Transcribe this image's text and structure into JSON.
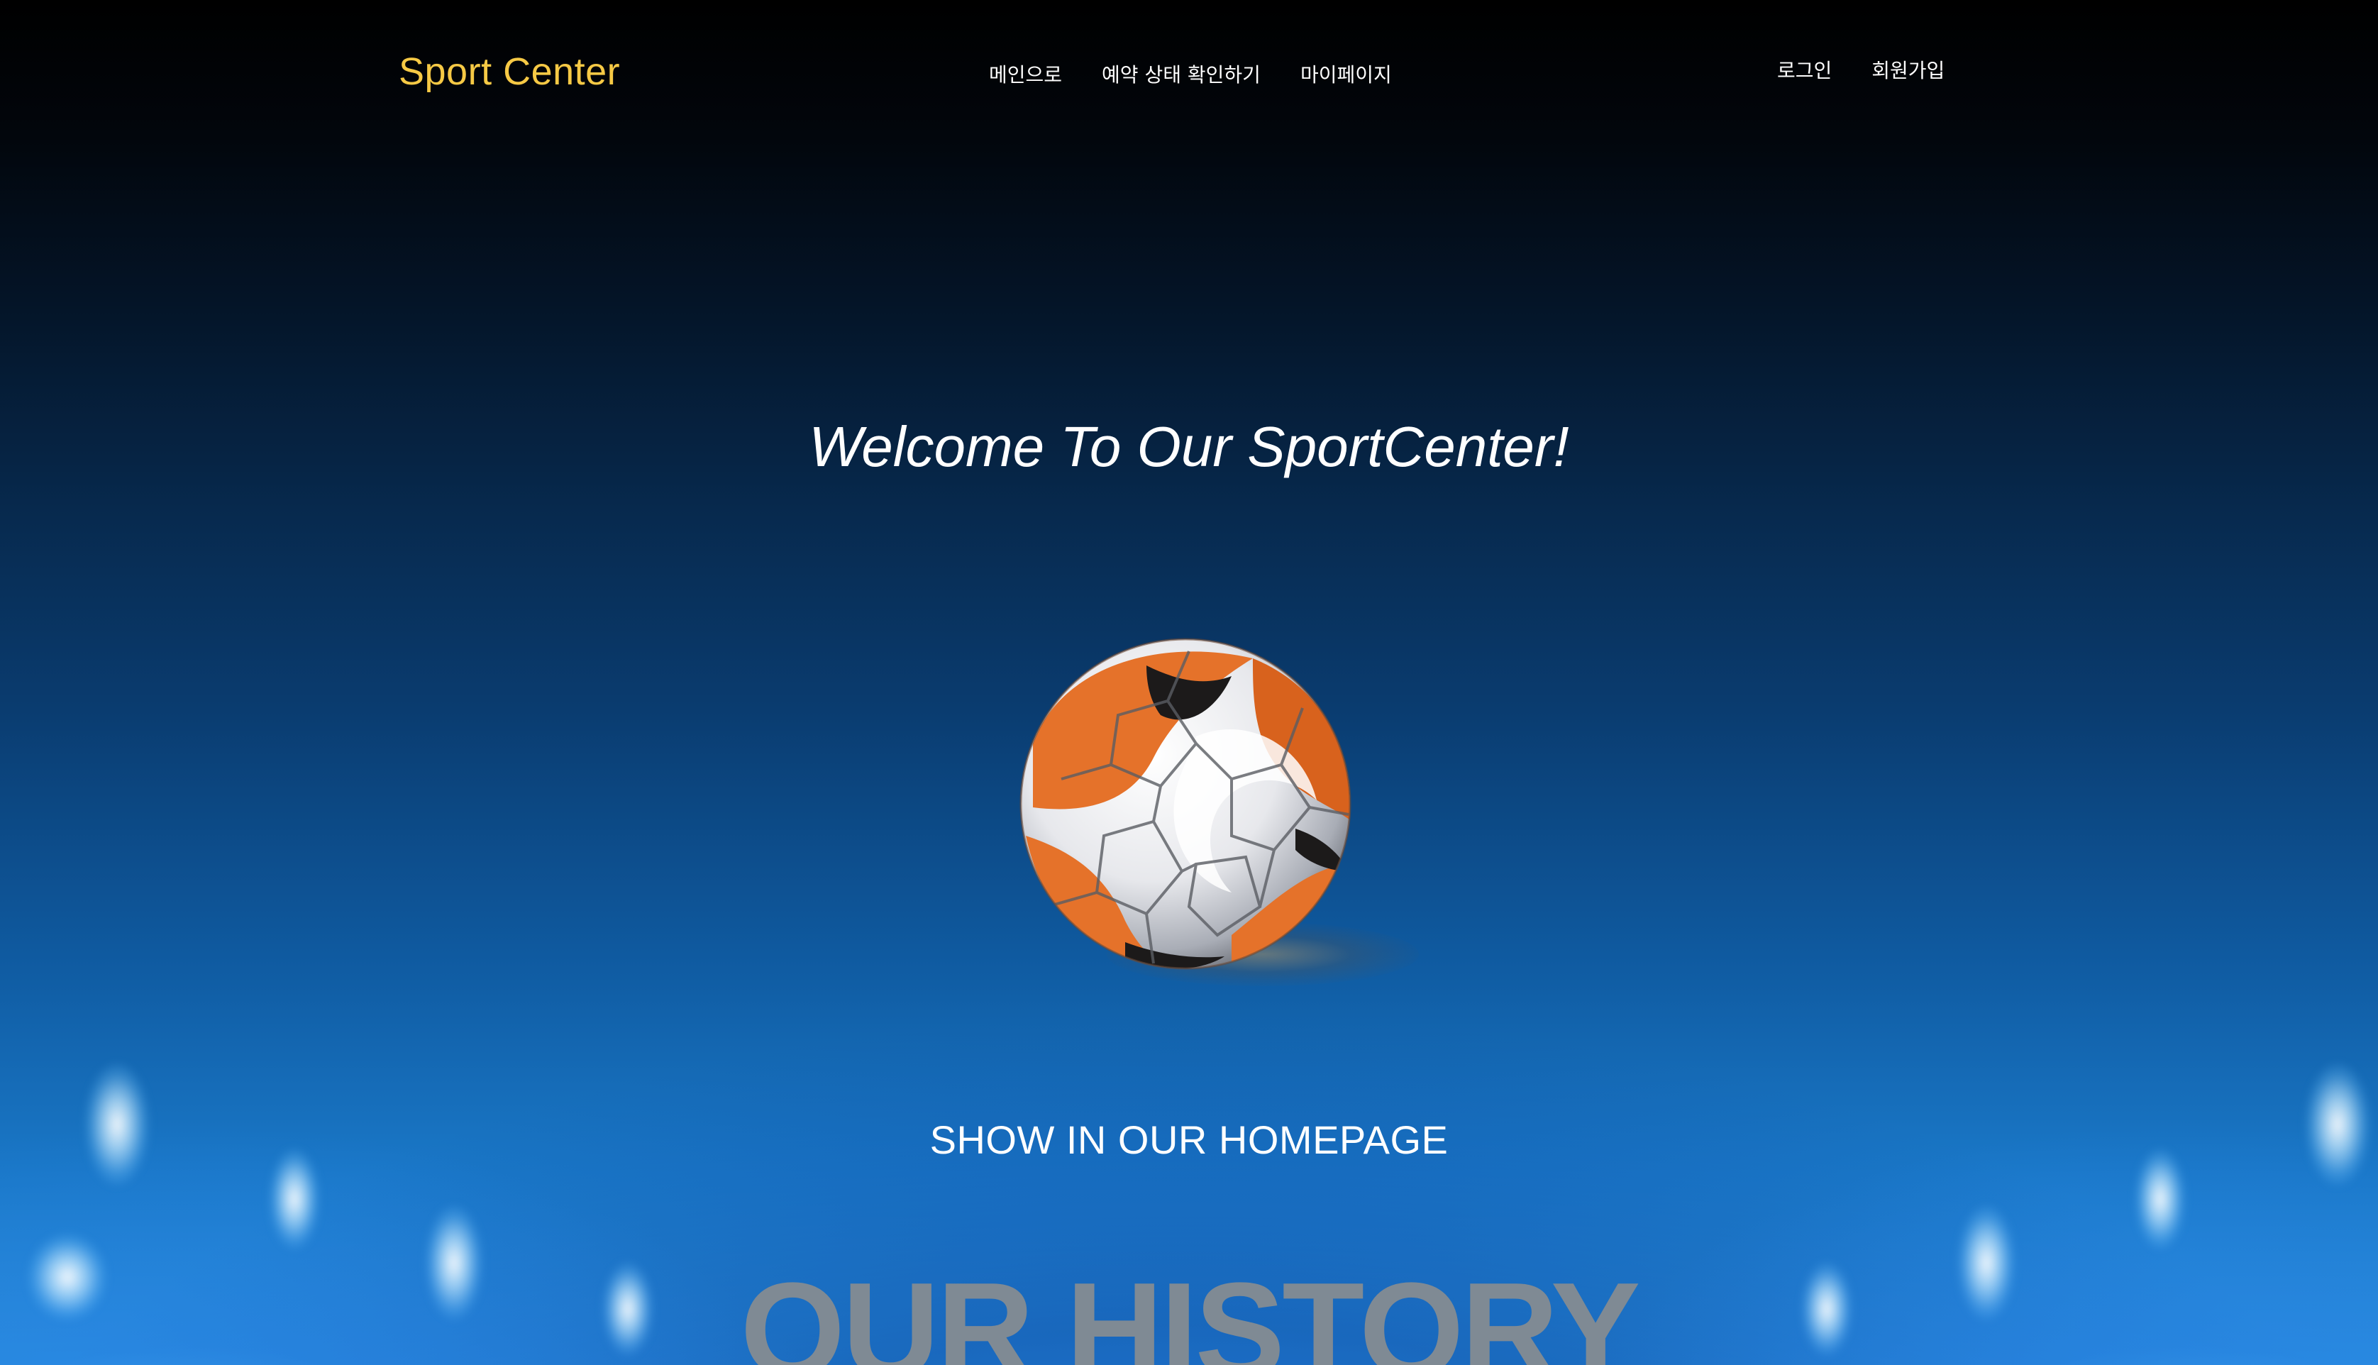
{
  "nav": {
    "brand": "Sport Center",
    "menu": {
      "main": "메인으로",
      "reservation_status": "예약 상태 확인하기",
      "mypage": "마이페이지"
    },
    "auth": {
      "login": "로그인",
      "signup": "회원가입"
    }
  },
  "hero": {
    "welcome": "Welcome To Our SportCenter!",
    "show": "SHOW IN OUR HOMEPAGE"
  },
  "section": {
    "history_title": "OUR HISTORY"
  },
  "colors": {
    "brand": "#f6c945",
    "ball_orange": "#e5722a",
    "history_text": "#7f8a94"
  },
  "icons": {
    "ball": "soccer-ball-icon"
  }
}
